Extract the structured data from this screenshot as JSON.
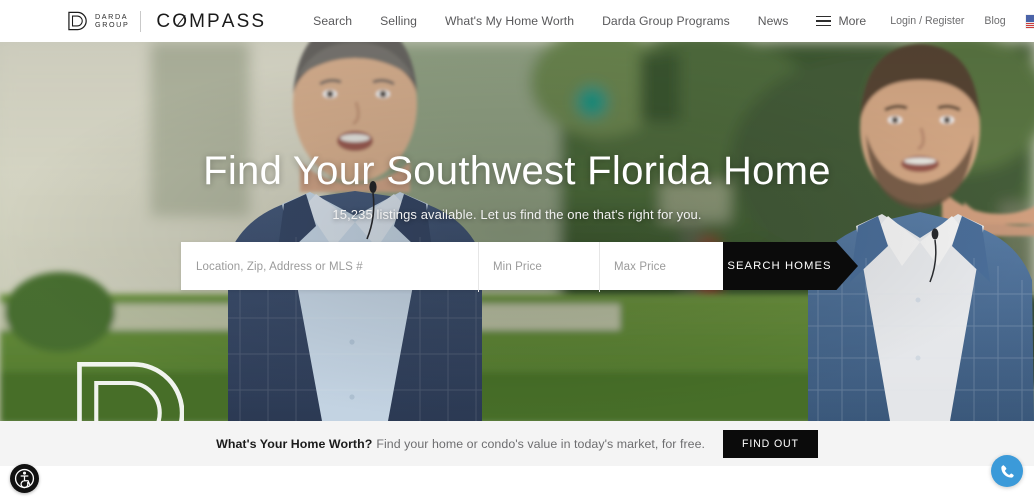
{
  "header": {
    "brand": {
      "mark_icon": "darda-d-monogram-icon",
      "line1": "DARDA",
      "line2": "GROUP",
      "partner": "COMPASS"
    },
    "nav": [
      {
        "label": "Search",
        "name": "nav-item-search"
      },
      {
        "label": "Selling",
        "name": "nav-item-selling"
      },
      {
        "label": "What's My Home Worth",
        "name": "nav-item-whats-my-home-worth"
      },
      {
        "label": "Darda Group Programs",
        "name": "nav-item-darda-group-programs"
      },
      {
        "label": "News",
        "name": "nav-item-news"
      }
    ],
    "more": {
      "label": "More",
      "icon": "hamburger-icon"
    },
    "login": "Login / Register",
    "blog": "Blog",
    "locale": {
      "flag": "us-flag-icon",
      "chevron": "chevron-down-icon"
    }
  },
  "hero": {
    "title": "Find Your Southwest Florida Home",
    "subtitle": "15,235 listings available. Let us find the one that's right for you.",
    "listings_count": "15,235",
    "watermark_icon": "darda-d-watermark-icon"
  },
  "search": {
    "location_placeholder": "Location, Zip, Address or MLS #",
    "location_value": "",
    "min_price_placeholder": "Min Price",
    "min_price_value": "",
    "max_price_placeholder": "Max Price",
    "max_price_value": "",
    "submit_label": "SEARCH HOMES"
  },
  "cta": {
    "headline": "What's Your Home Worth?",
    "description": "Find your home or condo's value in today's market, for free.",
    "button_label": "FIND OUT"
  },
  "widgets": {
    "accessibility_icon": "accessibility-wheelchair-icon",
    "call_icon": "phone-icon"
  },
  "colors": {
    "accent_black": "#0b0b0b",
    "call_blue": "#3b9ad9",
    "cta_bg": "#f4f4f4",
    "nav_text": "#59595b"
  }
}
